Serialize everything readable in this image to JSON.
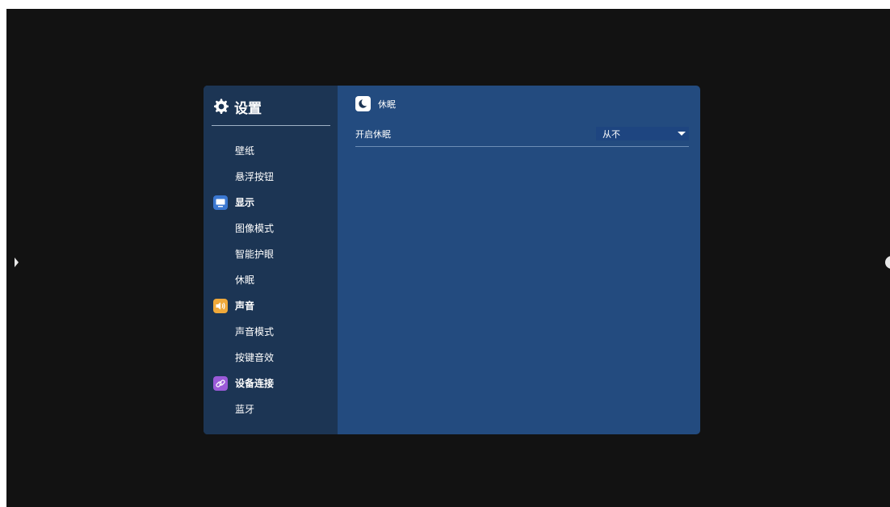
{
  "sidebar": {
    "title": "设置",
    "items": [
      {
        "type": "item",
        "label": "壁纸"
      },
      {
        "type": "item",
        "label": "悬浮按钮"
      },
      {
        "type": "category",
        "label": "显示",
        "icon": "display-icon",
        "color": "#3b78d2"
      },
      {
        "type": "item",
        "label": "图像模式"
      },
      {
        "type": "item",
        "label": "智能护眼"
      },
      {
        "type": "item",
        "label": "休眠"
      },
      {
        "type": "category",
        "label": "声音",
        "icon": "speaker-icon",
        "color": "#f0a93a"
      },
      {
        "type": "item",
        "label": "声音模式"
      },
      {
        "type": "item",
        "label": "按键音效"
      },
      {
        "type": "category",
        "label": "设备连接",
        "icon": "link-icon",
        "color": "#9b5ad8"
      },
      {
        "type": "item",
        "label": "蓝牙"
      }
    ]
  },
  "content": {
    "title": "休眠",
    "icon": "moon-icon",
    "rows": [
      {
        "label": "开启休眠",
        "value": "从不"
      }
    ]
  },
  "colors": {
    "background": "#121212",
    "panel": "#234b7f",
    "sidebar": "#1c3554",
    "select": "#1e4580"
  }
}
